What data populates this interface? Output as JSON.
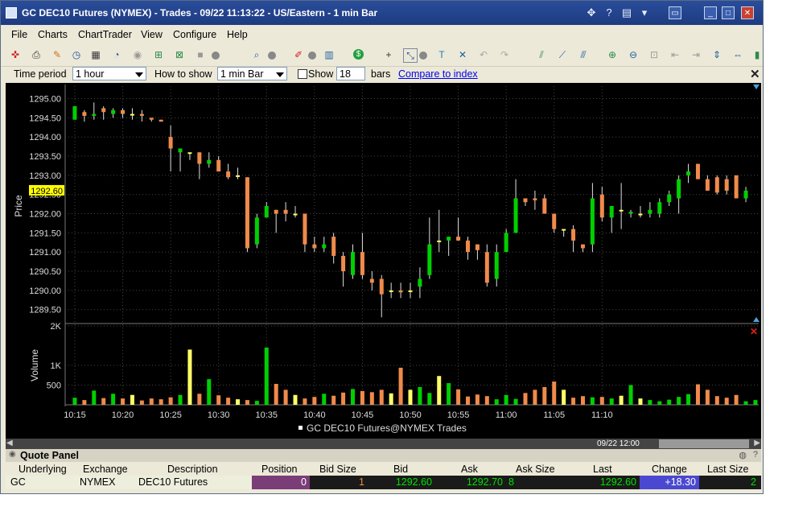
{
  "window": {
    "title": "GC DEC10 Futures (NYMEX) - Trades - 09/22 11:13:22 - US/Eastern - 1 min Bar"
  },
  "menu": [
    "File",
    "Charts",
    "ChartTrader",
    "View",
    "Configure",
    "Help"
  ],
  "settings": {
    "time_period_label": "Time period",
    "time_period_value": "1 hour",
    "how_to_show_label": "How to show",
    "how_to_show_value": "1 min Bar",
    "show_label": "Show",
    "show_value": "18",
    "bars_label": "bars",
    "compare_link": "Compare to index"
  },
  "chart_data": [
    {
      "type": "candlestick",
      "title": "",
      "ylabel": "Price",
      "ylim": [
        1289.2,
        1295.2
      ],
      "yticks": [
        "1295.00",
        "1294.50",
        "1294.00",
        "1293.50",
        "1293.00",
        "1292.50",
        "1292.00",
        "1291.50",
        "1291.00",
        "1290.50",
        "1290.00",
        "1289.50"
      ],
      "current_price_label": "1292.60",
      "xticks": [
        "10:15",
        "10:20",
        "10:25",
        "10:30",
        "10:35",
        "10:40",
        "10:45",
        "10:50",
        "10:55",
        "11:00",
        "11:05",
        "11:10"
      ],
      "colors": {
        "up": "#00d000",
        "down": "#f08a4b",
        "flat": "#ffff66"
      },
      "bars": [
        {
          "o": 1294.45,
          "h": 1294.8,
          "l": 1294.45,
          "c": 1294.8
        },
        {
          "o": 1294.65,
          "h": 1294.7,
          "l": 1294.4,
          "c": 1294.55
        },
        {
          "o": 1294.55,
          "h": 1294.9,
          "l": 1294.45,
          "c": 1294.6
        },
        {
          "o": 1294.75,
          "h": 1294.8,
          "l": 1294.45,
          "c": 1294.65
        },
        {
          "o": 1294.6,
          "h": 1294.75,
          "l": 1294.5,
          "c": 1294.7
        },
        {
          "o": 1294.7,
          "h": 1294.75,
          "l": 1294.5,
          "c": 1294.6
        },
        {
          "o": 1294.6,
          "h": 1294.75,
          "l": 1294.45,
          "c": 1294.6
        },
        {
          "o": 1294.6,
          "h": 1294.7,
          "l": 1294.4,
          "c": 1294.55
        },
        {
          "o": 1294.5,
          "h": 1294.5,
          "l": 1294.4,
          "c": 1294.45
        },
        {
          "o": 1294.45,
          "h": 1294.45,
          "l": 1294.4,
          "c": 1294.4
        },
        {
          "o": 1294.0,
          "h": 1294.3,
          "l": 1293.1,
          "c": 1293.7
        },
        {
          "o": 1293.6,
          "h": 1293.7,
          "l": 1293.1,
          "c": 1293.7
        },
        {
          "o": 1293.6,
          "h": 1293.6,
          "l": 1293.4,
          "c": 1293.6
        },
        {
          "o": 1293.6,
          "h": 1293.6,
          "l": 1292.9,
          "c": 1293.3
        },
        {
          "o": 1293.3,
          "h": 1293.6,
          "l": 1293.2,
          "c": 1293.4
        },
        {
          "o": 1293.4,
          "h": 1293.5,
          "l": 1293.1,
          "c": 1293.1
        },
        {
          "o": 1293.1,
          "h": 1293.3,
          "l": 1292.9,
          "c": 1292.95
        },
        {
          "o": 1293.0,
          "h": 1293.2,
          "l": 1292.9,
          "c": 1293.0
        },
        {
          "o": 1292.95,
          "h": 1292.95,
          "l": 1291.0,
          "c": 1291.1
        },
        {
          "o": 1291.2,
          "h": 1292.0,
          "l": 1291.1,
          "c": 1291.9
        },
        {
          "o": 1291.9,
          "h": 1292.3,
          "l": 1291.9,
          "c": 1292.2
        },
        {
          "o": 1292.1,
          "h": 1292.1,
          "l": 1291.5,
          "c": 1292.0
        },
        {
          "o": 1292.1,
          "h": 1292.3,
          "l": 1291.8,
          "c": 1292.0
        },
        {
          "o": 1292.0,
          "h": 1292.2,
          "l": 1291.9,
          "c": 1292.0
        },
        {
          "o": 1292.0,
          "h": 1292.0,
          "l": 1291.0,
          "c": 1291.2
        },
        {
          "o": 1291.2,
          "h": 1291.4,
          "l": 1291.0,
          "c": 1291.1
        },
        {
          "o": 1291.1,
          "h": 1291.4,
          "l": 1291.0,
          "c": 1291.2
        },
        {
          "o": 1291.4,
          "h": 1291.5,
          "l": 1290.7,
          "c": 1290.9
        },
        {
          "o": 1290.9,
          "h": 1291.0,
          "l": 1290.1,
          "c": 1290.5
        },
        {
          "o": 1290.4,
          "h": 1291.2,
          "l": 1290.3,
          "c": 1291.0
        },
        {
          "o": 1291.0,
          "h": 1291.5,
          "l": 1290.3,
          "c": 1290.4
        },
        {
          "o": 1290.3,
          "h": 1290.5,
          "l": 1290.0,
          "c": 1290.2
        },
        {
          "o": 1290.3,
          "h": 1290.4,
          "l": 1289.3,
          "c": 1289.9
        },
        {
          "o": 1290.0,
          "h": 1290.2,
          "l": 1289.8,
          "c": 1290.0
        },
        {
          "o": 1290.0,
          "h": 1290.2,
          "l": 1289.8,
          "c": 1289.95
        },
        {
          "o": 1290.0,
          "h": 1290.2,
          "l": 1289.8,
          "c": 1290.0
        },
        {
          "o": 1290.1,
          "h": 1290.6,
          "l": 1289.8,
          "c": 1290.3
        },
        {
          "o": 1290.4,
          "h": 1291.9,
          "l": 1290.3,
          "c": 1291.2
        },
        {
          "o": 1291.3,
          "h": 1292.1,
          "l": 1291.0,
          "c": 1291.3
        },
        {
          "o": 1291.3,
          "h": 1291.4,
          "l": 1290.9,
          "c": 1291.4
        },
        {
          "o": 1291.4,
          "h": 1291.9,
          "l": 1291.3,
          "c": 1291.3
        },
        {
          "o": 1291.3,
          "h": 1291.4,
          "l": 1290.8,
          "c": 1291.0
        },
        {
          "o": 1291.2,
          "h": 1291.2,
          "l": 1290.8,
          "c": 1291.05
        },
        {
          "o": 1291.0,
          "h": 1291.2,
          "l": 1290.1,
          "c": 1290.2
        },
        {
          "o": 1290.3,
          "h": 1291.2,
          "l": 1290.1,
          "c": 1291.0
        },
        {
          "o": 1291.0,
          "h": 1291.6,
          "l": 1291.0,
          "c": 1291.5
        },
        {
          "o": 1291.5,
          "h": 1292.9,
          "l": 1291.5,
          "c": 1292.4
        },
        {
          "o": 1292.4,
          "h": 1292.4,
          "l": 1292.2,
          "c": 1292.3
        },
        {
          "o": 1292.4,
          "h": 1292.6,
          "l": 1292.1,
          "c": 1292.35
        },
        {
          "o": 1292.4,
          "h": 1292.5,
          "l": 1292.0,
          "c": 1292.0
        },
        {
          "o": 1292.0,
          "h": 1292.0,
          "l": 1291.5,
          "c": 1291.6
        },
        {
          "o": 1291.6,
          "h": 1291.6,
          "l": 1291.4,
          "c": 1291.6
        },
        {
          "o": 1291.6,
          "h": 1291.7,
          "l": 1291.0,
          "c": 1291.3
        },
        {
          "o": 1291.2,
          "h": 1291.2,
          "l": 1291.0,
          "c": 1291.1
        },
        {
          "o": 1291.2,
          "h": 1292.8,
          "l": 1291.0,
          "c": 1292.4
        },
        {
          "o": 1292.5,
          "h": 1292.7,
          "l": 1291.8,
          "c": 1291.9
        },
        {
          "o": 1291.9,
          "h": 1292.1,
          "l": 1291.5,
          "c": 1292.2
        },
        {
          "o": 1292.1,
          "h": 1292.8,
          "l": 1291.6,
          "c": 1292.1
        },
        {
          "o": 1292.0,
          "h": 1292.1,
          "l": 1291.9,
          "c": 1292.05
        },
        {
          "o": 1292.0,
          "h": 1292.2,
          "l": 1291.9,
          "c": 1292.0
        },
        {
          "o": 1292.0,
          "h": 1292.3,
          "l": 1291.9,
          "c": 1292.1
        },
        {
          "o": 1292.0,
          "h": 1292.4,
          "l": 1291.9,
          "c": 1292.3
        },
        {
          "o": 1292.3,
          "h": 1292.6,
          "l": 1292.2,
          "c": 1292.5
        },
        {
          "o": 1292.4,
          "h": 1293.0,
          "l": 1292.0,
          "c": 1292.9
        },
        {
          "o": 1293.0,
          "h": 1293.3,
          "l": 1292.8,
          "c": 1293.1
        },
        {
          "o": 1293.3,
          "h": 1293.3,
          "l": 1292.9,
          "c": 1292.9
        },
        {
          "o": 1292.9,
          "h": 1293.0,
          "l": 1292.6,
          "c": 1292.6
        },
        {
          "o": 1292.95,
          "h": 1293.0,
          "l": 1292.5,
          "c": 1292.55
        },
        {
          "o": 1292.9,
          "h": 1293.0,
          "l": 1292.5,
          "c": 1292.6
        },
        {
          "o": 1293.0,
          "h": 1293.0,
          "l": 1292.4,
          "c": 1292.4
        },
        {
          "o": 1292.4,
          "h": 1292.7,
          "l": 1292.3,
          "c": 1292.6
        }
      ]
    },
    {
      "type": "bar",
      "title": "",
      "ylabel": "Volume",
      "ylim": [
        0,
        2000
      ],
      "yticks": [
        "2K",
        "1K",
        "500"
      ],
      "legend": "GC DEC10 Futures@NYMEX Trades",
      "values": [
        180,
        120,
        360,
        170,
        280,
        160,
        250,
        110,
        160,
        140,
        190,
        250,
        1400,
        280,
        650,
        240,
        180,
        140,
        120,
        100,
        1450,
        530,
        380,
        250,
        160,
        200,
        280,
        230,
        310,
        400,
        350,
        320,
        380,
        290,
        940,
        380,
        450,
        300,
        730,
        550,
        390,
        210,
        260,
        220,
        140,
        250,
        150,
        300,
        380,
        450,
        590,
        380,
        180,
        220,
        190,
        200,
        160,
        230,
        500,
        160,
        120,
        90,
        130,
        200,
        270,
        520,
        380,
        220,
        180,
        250,
        90,
        120
      ],
      "colors": {
        "up": "#00d000",
        "down": "#f08a4b",
        "flat": "#ffff66"
      }
    }
  ],
  "scrollbar": {
    "date_label": "09/22 12:00"
  },
  "quote_panel": {
    "title": "Quote Panel",
    "columns": [
      "Underlying",
      "Exchange",
      "Description",
      "Position",
      "Bid Size",
      "Bid",
      "Ask",
      "Ask Size",
      "Last",
      "Change",
      "Last Size"
    ],
    "row": {
      "underlying": "GC",
      "exchange": "NYMEX",
      "description": "DEC10 Futures",
      "position": "0",
      "bid_size": "1",
      "bid": "1292.60",
      "ask": "1292.70",
      "ask_size": "8",
      "last": "1292.60",
      "change": "+18.30",
      "last_size": "2"
    }
  }
}
